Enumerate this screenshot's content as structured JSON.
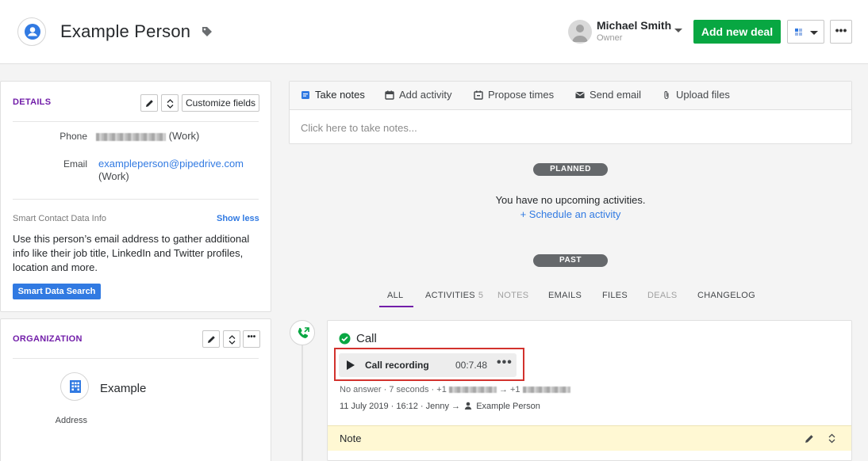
{
  "header": {
    "title": "Example Person",
    "owner_name": "Michael Smith",
    "owner_role": "Owner",
    "add_deal_label": "Add new deal",
    "more_label": "•••"
  },
  "details": {
    "title": "DETAILS",
    "customize_label": "Customize fields",
    "phone_label": "Phone",
    "phone_suffix": "(Work)",
    "email_label": "Email",
    "email_value": "exampleperson@pipedrive.com",
    "email_suffix": "(Work)",
    "smart_contact_label": "Smart Contact Data Info",
    "show_less_label": "Show less",
    "smart_description": "Use this person’s email address to gather additional info like their job title, LinkedIn and Twitter profiles, location and more.",
    "smart_button_label": "Smart Data Search"
  },
  "organization": {
    "title": "ORGANIZATION",
    "name": "Example",
    "address_label": "Address",
    "more_label": "•••"
  },
  "composer": {
    "tabs": [
      {
        "label": "Take notes",
        "icon": "note-icon"
      },
      {
        "label": "Add activity",
        "icon": "calendar-icon"
      },
      {
        "label": "Propose times",
        "icon": "propose-calendar-icon"
      },
      {
        "label": "Send email",
        "icon": "mail-icon"
      },
      {
        "label": "Upload files",
        "icon": "paperclip-icon"
      }
    ],
    "placeholder": "Click here to take notes..."
  },
  "timeline": {
    "planned_label": "PLANNED",
    "no_activities": "You have no upcoming activities.",
    "schedule_link": "+ Schedule an activity",
    "past_label": "PAST",
    "filters": [
      {
        "label": "ALL"
      },
      {
        "label": "ACTIVITIES",
        "count": "5"
      },
      {
        "label": "NOTES"
      },
      {
        "label": "EMAILS"
      },
      {
        "label": "FILES"
      },
      {
        "label": "DEALS"
      },
      {
        "label": "CHANGELOG"
      }
    ]
  },
  "call": {
    "title": "Call",
    "recording_label": "Call recording",
    "recording_time": "00:7.48",
    "recording_more": "•••",
    "meta_result": "No answer · 7 seconds · +1",
    "meta_arrow": "→ +1",
    "date": "11 July 2019 · 16:12 · Jenny →",
    "contact": "Example Person",
    "note_label": "Note"
  },
  "colors": {
    "accent_green": "#08a742",
    "link_blue": "#317ae2",
    "purple": "#721ea9",
    "highlight_red": "#d2322d",
    "note_yellow": "#fff8d3"
  }
}
